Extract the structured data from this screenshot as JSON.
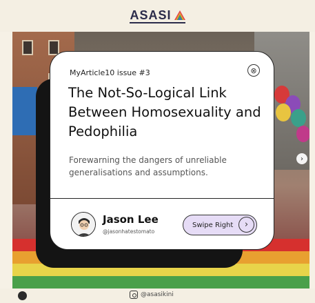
{
  "header": {
    "brand": "ASASI"
  },
  "card": {
    "issue": "MyArticle10 issue #3",
    "close_icon": "⊗",
    "title": "The Not-So-Logical Link Between Homosexuality and Pedophilia",
    "subtitle": "Forewarning the dangers of unreliable generalisations and assumptions.",
    "author": {
      "name": "Jason Lee",
      "handle": "@jasonhatestomato"
    },
    "swipe_label": "Swipe Right",
    "swipe_icon": "›"
  },
  "nav": {
    "next_icon": "›"
  },
  "footer": {
    "instagram": "@asasikini"
  },
  "colors": {
    "accent": "#e6dcf6",
    "brand": "#2b2b4a",
    "background": "#f4efe3"
  }
}
